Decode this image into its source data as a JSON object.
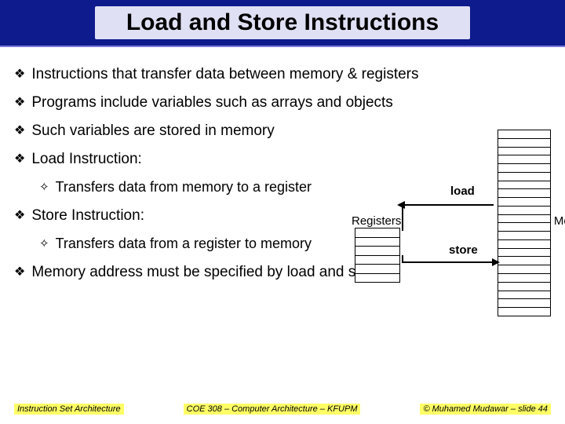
{
  "title": "Load and Store Instructions",
  "bullets": {
    "b1": "Instructions that transfer data between memory & registers",
    "b2": "Programs include variables such as arrays and objects",
    "b3": "Such variables are stored in memory",
    "b4": "Load Instruction:",
    "b4s": "Transfers data from memory to a register",
    "b5": "Store Instruction:",
    "b5s": "Transfers data from a register to memory",
    "b6": "Memory address must be specified by load and store"
  },
  "diagram": {
    "load": "load",
    "store": "store",
    "registers": "Registers",
    "memory": "Memory"
  },
  "footer": {
    "left": "Instruction Set Architecture",
    "center": "COE 308 – Computer Architecture – KFUPM",
    "right": "© Muhamed Mudawar – slide 44"
  }
}
